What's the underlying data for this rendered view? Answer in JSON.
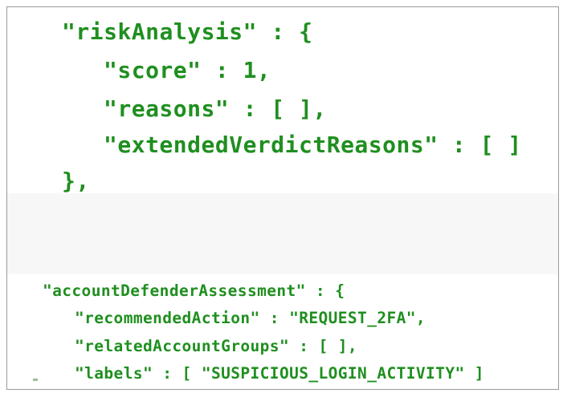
{
  "top_block": {
    "lines": [
      "\"riskAnalysis\" : {",
      "\"score\" : 1,",
      "\"reasons\" : [ ],",
      "\"extendedVerdictReasons\" : [ ]",
      "},"
    ]
  },
  "bottom_block": {
    "lines": [
      "\"accountDefenderAssessment\" : {",
      "\"recommendedAction\" : \"REQUEST_2FA\",",
      "\"relatedAccountGroups\" : [ ],",
      "\"labels\" : [ \"SUSPICIOUS_LOGIN_ACTIVITY\" ]"
    ]
  },
  "colors": {
    "code_text": "#1f8f1f",
    "gap_background": "#f6f7f6",
    "border": "#9a9a9a"
  }
}
